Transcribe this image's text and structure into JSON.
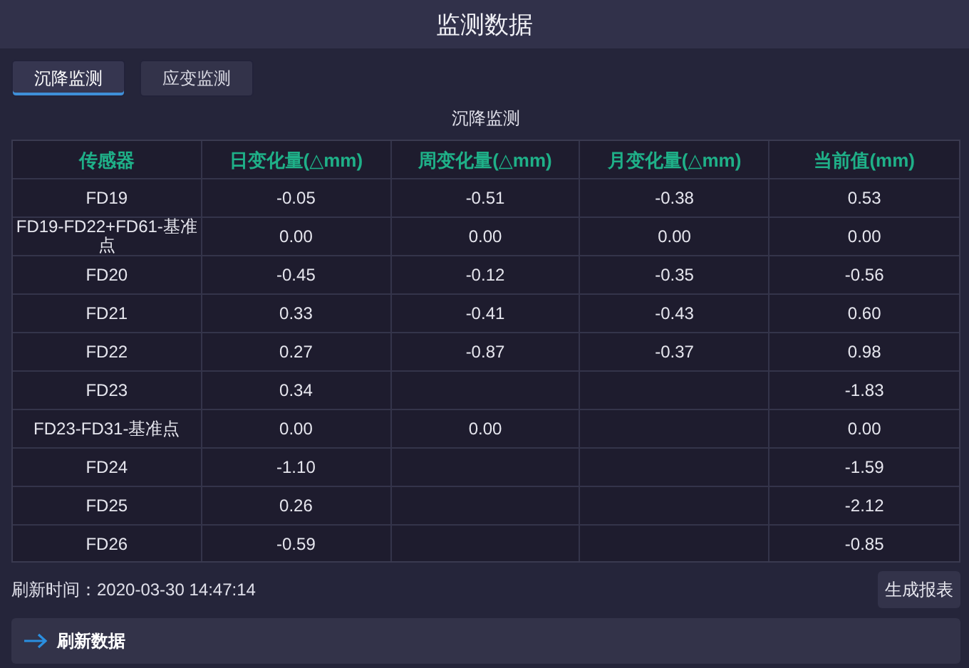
{
  "window": {
    "title": "监测数据"
  },
  "tabs": [
    {
      "label": "沉降监测",
      "selected": true
    },
    {
      "label": "应变监测",
      "selected": false
    }
  ],
  "table": {
    "caption": "沉降监测",
    "columns": [
      "传感器",
      "日变化量(△mm)",
      "周变化量(△mm)",
      "月变化量(△mm)",
      "当前值(mm)"
    ],
    "rows": [
      [
        "FD19",
        "-0.05",
        "-0.51",
        "-0.38",
        "0.53"
      ],
      [
        "FD19-FD22+FD61-基准点",
        "0.00",
        "0.00",
        "0.00",
        "0.00"
      ],
      [
        "FD20",
        "-0.45",
        "-0.12",
        "-0.35",
        "-0.56"
      ],
      [
        "FD21",
        "0.33",
        "-0.41",
        "-0.43",
        "0.60"
      ],
      [
        "FD22",
        "0.27",
        "-0.87",
        "-0.37",
        "0.98"
      ],
      [
        "FD23",
        "0.34",
        "",
        "",
        "-1.83"
      ],
      [
        "FD23-FD31-基准点",
        "0.00",
        "0.00",
        "",
        "0.00"
      ],
      [
        "FD24",
        "-1.10",
        "",
        "",
        "-1.59"
      ],
      [
        "FD25",
        "0.26",
        "",
        "",
        "-2.12"
      ],
      [
        "FD26",
        "-0.59",
        "",
        "",
        "-0.85"
      ]
    ]
  },
  "status": {
    "refresh_time": "刷新时间：2020-03-30 14:47:14",
    "report_button": "生成报表"
  },
  "action_bar": {
    "label": "刷新数据"
  }
}
